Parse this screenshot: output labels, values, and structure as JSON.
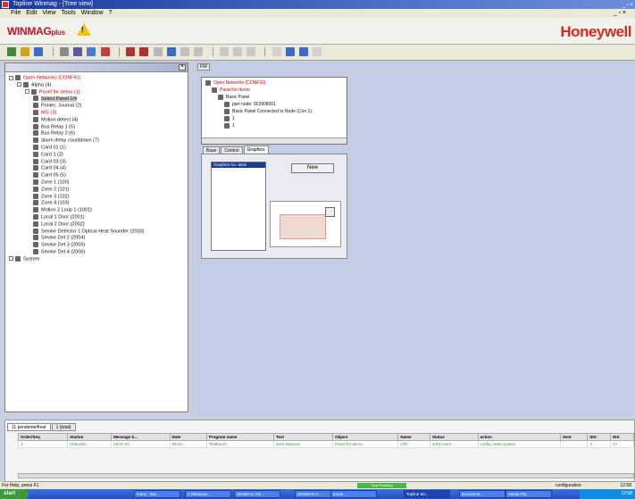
{
  "window": {
    "title": "Topline Winmag - [Tree view]",
    "menu": [
      "File",
      "Edit",
      "View",
      "Tools",
      "Window",
      "?"
    ],
    "mdi_controls": "_ ▫ ×",
    "win_controls": "_ ▫ ×"
  },
  "brand": {
    "product": "WINMAG",
    "product_sub": "plus",
    "vendor": "Honeywell",
    "warning": "!"
  },
  "tree": {
    "items": [
      {
        "label": "Open Networks [CONFIG]",
        "level": 0,
        "red": true,
        "expander": true
      },
      {
        "label": "Alpha (4)",
        "level": 1,
        "red": false,
        "expander": true
      },
      {
        "label": "Panel for demo (1)",
        "level": 2,
        "red": true,
        "expander": true
      },
      {
        "label": "Select Panel 1/4",
        "level": 3,
        "red": false,
        "sel": true
      },
      {
        "label": "Printer, Journal (2)",
        "level": 3,
        "red": false
      },
      {
        "label": "MG (3)",
        "level": 3,
        "red": true
      },
      {
        "label": "Motion detect (4)",
        "level": 3,
        "red": false
      },
      {
        "label": "Bus Relay 1 (5)",
        "level": 3,
        "red": false
      },
      {
        "label": "Bus Relay 2 (6)",
        "level": 3,
        "red": false
      },
      {
        "label": "alarm delay countdown (7)",
        "level": 3,
        "red": false
      },
      {
        "label": "Card 01 (1)",
        "level": 3,
        "red": false
      },
      {
        "label": "Card 1 (2)",
        "level": 3,
        "red": false
      },
      {
        "label": "Card 03 (3)",
        "level": 3,
        "red": false
      },
      {
        "label": "Card 04 (4)",
        "level": 3,
        "red": false
      },
      {
        "label": "Card 05 (5)",
        "level": 3,
        "red": false
      },
      {
        "label": "Zone 1 (100)",
        "level": 3,
        "red": false
      },
      {
        "label": "Zone 2 (101)",
        "level": 3,
        "red": false
      },
      {
        "label": "Zone 3 (102)",
        "level": 3,
        "red": false
      },
      {
        "label": "Zone 4 (103)",
        "level": 3,
        "red": false
      },
      {
        "label": "Motion 2 Loop 1 (1001)",
        "level": 3,
        "red": false
      },
      {
        "label": "Local 1 Door (2001)",
        "level": 3,
        "red": false
      },
      {
        "label": "Local 2 Door (2002)",
        "level": 3,
        "red": false
      },
      {
        "label": "Smoke Detector 1 Optical Heat Sounder (2003)",
        "level": 3,
        "red": false
      },
      {
        "label": "Smoke Det 2 (2004)",
        "level": 3,
        "red": false
      },
      {
        "label": "Smoke Det 3 (2005)",
        "level": 3,
        "red": false
      },
      {
        "label": "Smoke Det 4 (2006)",
        "level": 3,
        "red": false
      },
      {
        "label": "System",
        "level": 0,
        "red": false,
        "expander": true
      }
    ]
  },
  "main": {
    "fw_tab": "FW",
    "mini_tree": [
      {
        "label": "Open Networks [CONFIG]",
        "level": 0,
        "red": true
      },
      {
        "label": "Panel for demo",
        "level": 1,
        "red": true
      },
      {
        "label": "Basic Panel",
        "level": 2,
        "red": false
      },
      {
        "label": "part node: 003908001",
        "level": 3,
        "red": false
      },
      {
        "label": "Basic Panel Connected to Node (Con 1)",
        "level": 3,
        "red": false
      },
      {
        "label": "1",
        "level": 3,
        "red": false
      },
      {
        "label": "1",
        "level": 3,
        "red": false
      }
    ],
    "prop_tabs": [
      "Base",
      "Control",
      "Graphics"
    ],
    "active_tab": 2,
    "graphics_list": [
      "Graphics No. Main"
    ],
    "new_button": "New"
  },
  "bottom": {
    "tabs": [
      "11 pendente/frest",
      "1 (total)"
    ],
    "columns": [
      "Order/Seq",
      "Station",
      "Message ti...",
      "Date",
      "Program name",
      "Text",
      "Object",
      "Name",
      "Status",
      "action",
      "Sent",
      "IDX",
      "IDX"
    ],
    "rows": [
      [
        "1",
        "Unknown",
        "03.07.03",
        "08.03...",
        "TestEvent",
        "Dest Network",
        "Panel for demo",
        "LTD",
        "4401 Inact",
        "config. state system",
        "",
        "4",
        "17"
      ]
    ]
  },
  "status": {
    "left": "For Help, press F1",
    "progress": "Now Running",
    "config": "configuration",
    "time": "12:58"
  },
  "taskbar": {
    "start": "start",
    "buttons": [
      "Inbox - Mic...",
      "2 Windows...",
      "WINMAG Onl...",
      "WINMAG-A...",
      "Excel...",
      "Topline Wi...",
      "Document...",
      "Media Pla..."
    ],
    "active_button": 5,
    "tray_time": "12:58"
  },
  "colors": {
    "brand_red": "#c8102e",
    "honeywell_red": "#d52b1e",
    "workspace": "#c3cde6",
    "alarm_green": "#2e9d2e"
  }
}
